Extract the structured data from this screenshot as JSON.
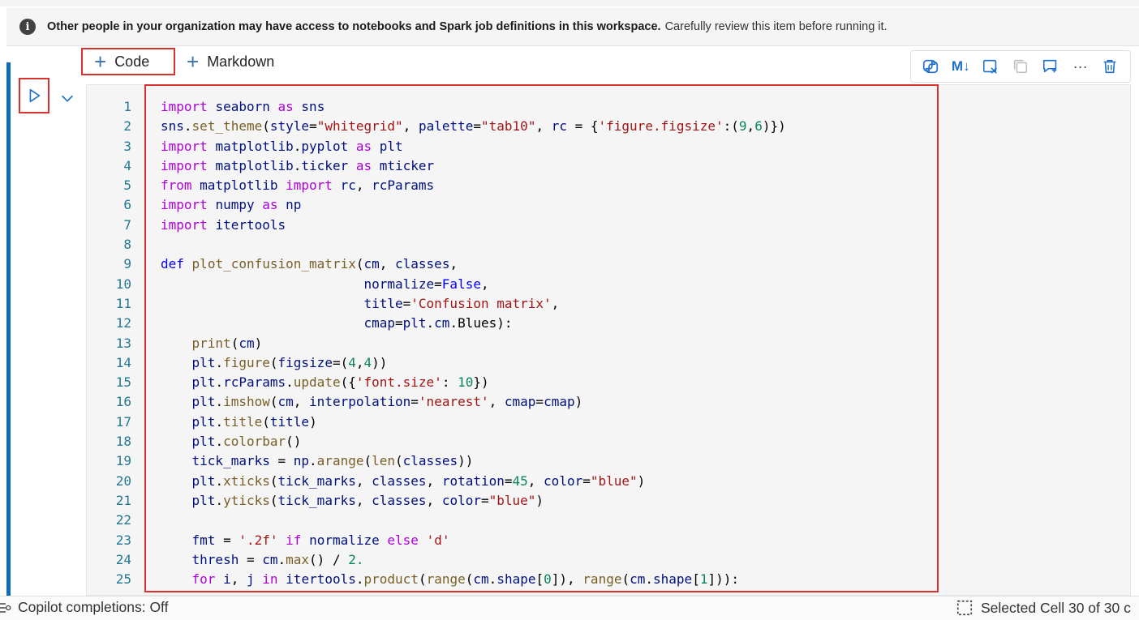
{
  "banner": {
    "bold_text": "Other people in your organization may have access to notebooks and Spark job definitions in this workspace.",
    "normal_text": "Carefully review this item before running it."
  },
  "add_toolbar": {
    "code_label": "Code",
    "markdown_label": "Markdown"
  },
  "cell_toolbar": {
    "markdown_toggle_label": "M↓",
    "more_label": "···",
    "icons": [
      "copilot-icon",
      "markdown-toggle-icon",
      "clear-output-icon",
      "copy-icon",
      "comment-icon",
      "more-icon",
      "delete-icon"
    ]
  },
  "colors": {
    "accent": "#0f6cbd",
    "highlight_border": "#d93030",
    "keyword": "#af00db",
    "string": "#a31515",
    "number": "#098658",
    "function": "#795e26",
    "variable": "#001080",
    "line_number": "#237893"
  },
  "code": {
    "lines": [
      [
        [
          "kw",
          "import"
        ],
        [
          "t",
          " "
        ],
        [
          "id",
          "seaborn"
        ],
        [
          "t",
          " "
        ],
        [
          "kw",
          "as"
        ],
        [
          "t",
          " "
        ],
        [
          "id",
          "sns"
        ]
      ],
      [
        [
          "id",
          "sns"
        ],
        [
          "t",
          "."
        ],
        [
          "fn",
          "set_theme"
        ],
        [
          "t",
          "("
        ],
        [
          "id",
          "style"
        ],
        [
          "t",
          "="
        ],
        [
          "st",
          "\"whitegrid\""
        ],
        [
          "t",
          ", "
        ],
        [
          "id",
          "palette"
        ],
        [
          "t",
          "="
        ],
        [
          "st",
          "\"tab10\""
        ],
        [
          "t",
          ", "
        ],
        [
          "id",
          "rc"
        ],
        [
          "t",
          " = {"
        ],
        [
          "st",
          "'figure.figsize'"
        ],
        [
          "t",
          ":("
        ],
        [
          "nm",
          "9"
        ],
        [
          "t",
          ","
        ],
        [
          "nm",
          "6"
        ],
        [
          "t",
          ")})"
        ]
      ],
      [
        [
          "kw",
          "import"
        ],
        [
          "t",
          " "
        ],
        [
          "id",
          "matplotlib"
        ],
        [
          "t",
          "."
        ],
        [
          "id",
          "pyplot"
        ],
        [
          "t",
          " "
        ],
        [
          "kw",
          "as"
        ],
        [
          "t",
          " "
        ],
        [
          "id",
          "plt"
        ]
      ],
      [
        [
          "kw",
          "import"
        ],
        [
          "t",
          " "
        ],
        [
          "id",
          "matplotlib"
        ],
        [
          "t",
          "."
        ],
        [
          "id",
          "ticker"
        ],
        [
          "t",
          " "
        ],
        [
          "kw",
          "as"
        ],
        [
          "t",
          " "
        ],
        [
          "id",
          "mticker"
        ]
      ],
      [
        [
          "kw",
          "from"
        ],
        [
          "t",
          " "
        ],
        [
          "id",
          "matplotlib"
        ],
        [
          "t",
          " "
        ],
        [
          "kw",
          "import"
        ],
        [
          "t",
          " "
        ],
        [
          "id",
          "rc"
        ],
        [
          "t",
          ", "
        ],
        [
          "id",
          "rcParams"
        ]
      ],
      [
        [
          "kw",
          "import"
        ],
        [
          "t",
          " "
        ],
        [
          "id",
          "numpy"
        ],
        [
          "t",
          " "
        ],
        [
          "kw",
          "as"
        ],
        [
          "t",
          " "
        ],
        [
          "id",
          "np"
        ]
      ],
      [
        [
          "kw",
          "import"
        ],
        [
          "t",
          " "
        ],
        [
          "id",
          "itertools"
        ]
      ],
      [],
      [
        [
          "kd",
          "def"
        ],
        [
          "t",
          " "
        ],
        [
          "fn",
          "plot_confusion_matrix"
        ],
        [
          "t",
          "("
        ],
        [
          "id",
          "cm"
        ],
        [
          "t",
          ", "
        ],
        [
          "id",
          "classes"
        ],
        [
          "t",
          ","
        ]
      ],
      [
        [
          "t",
          "                          "
        ],
        [
          "id",
          "normalize"
        ],
        [
          "t",
          "="
        ],
        [
          "kd",
          "False"
        ],
        [
          "t",
          ","
        ]
      ],
      [
        [
          "t",
          "                          "
        ],
        [
          "id",
          "title"
        ],
        [
          "t",
          "="
        ],
        [
          "st",
          "'Confusion matrix'"
        ],
        [
          "t",
          ","
        ]
      ],
      [
        [
          "t",
          "                          "
        ],
        [
          "id",
          "cmap"
        ],
        [
          "t",
          "="
        ],
        [
          "id",
          "plt"
        ],
        [
          "t",
          "."
        ],
        [
          "id",
          "cm"
        ],
        [
          "t",
          ".Blues):"
        ]
      ],
      [
        [
          "t",
          "    "
        ],
        [
          "fn",
          "print"
        ],
        [
          "t",
          "("
        ],
        [
          "id",
          "cm"
        ],
        [
          "t",
          ")"
        ]
      ],
      [
        [
          "t",
          "    "
        ],
        [
          "id",
          "plt"
        ],
        [
          "t",
          "."
        ],
        [
          "fn",
          "figure"
        ],
        [
          "t",
          "("
        ],
        [
          "id",
          "figsize"
        ],
        [
          "t",
          "=("
        ],
        [
          "nm",
          "4"
        ],
        [
          "t",
          ","
        ],
        [
          "nm",
          "4"
        ],
        [
          "t",
          "))"
        ]
      ],
      [
        [
          "t",
          "    "
        ],
        [
          "id",
          "plt"
        ],
        [
          "t",
          "."
        ],
        [
          "id",
          "rcParams"
        ],
        [
          "t",
          "."
        ],
        [
          "fn",
          "update"
        ],
        [
          "t",
          "({"
        ],
        [
          "st",
          "'font.size'"
        ],
        [
          "t",
          ": "
        ],
        [
          "nm",
          "10"
        ],
        [
          "t",
          "})"
        ]
      ],
      [
        [
          "t",
          "    "
        ],
        [
          "id",
          "plt"
        ],
        [
          "t",
          "."
        ],
        [
          "fn",
          "imshow"
        ],
        [
          "t",
          "("
        ],
        [
          "id",
          "cm"
        ],
        [
          "t",
          ", "
        ],
        [
          "id",
          "interpolation"
        ],
        [
          "t",
          "="
        ],
        [
          "st",
          "'nearest'"
        ],
        [
          "t",
          ", "
        ],
        [
          "id",
          "cmap"
        ],
        [
          "t",
          "="
        ],
        [
          "id",
          "cmap"
        ],
        [
          "t",
          ")"
        ]
      ],
      [
        [
          "t",
          "    "
        ],
        [
          "id",
          "plt"
        ],
        [
          "t",
          "."
        ],
        [
          "fn",
          "title"
        ],
        [
          "t",
          "("
        ],
        [
          "id",
          "title"
        ],
        [
          "t",
          ")"
        ]
      ],
      [
        [
          "t",
          "    "
        ],
        [
          "id",
          "plt"
        ],
        [
          "t",
          "."
        ],
        [
          "fn",
          "colorbar"
        ],
        [
          "t",
          "()"
        ]
      ],
      [
        [
          "t",
          "    "
        ],
        [
          "id",
          "tick_marks"
        ],
        [
          "t",
          " = "
        ],
        [
          "id",
          "np"
        ],
        [
          "t",
          "."
        ],
        [
          "fn",
          "arange"
        ],
        [
          "t",
          "("
        ],
        [
          "fn",
          "len"
        ],
        [
          "t",
          "("
        ],
        [
          "id",
          "classes"
        ],
        [
          "t",
          "))"
        ]
      ],
      [
        [
          "t",
          "    "
        ],
        [
          "id",
          "plt"
        ],
        [
          "t",
          "."
        ],
        [
          "fn",
          "xticks"
        ],
        [
          "t",
          "("
        ],
        [
          "id",
          "tick_marks"
        ],
        [
          "t",
          ", "
        ],
        [
          "id",
          "classes"
        ],
        [
          "t",
          ", "
        ],
        [
          "id",
          "rotation"
        ],
        [
          "t",
          "="
        ],
        [
          "nm",
          "45"
        ],
        [
          "t",
          ", "
        ],
        [
          "id",
          "color"
        ],
        [
          "t",
          "="
        ],
        [
          "st",
          "\"blue\""
        ],
        [
          "t",
          ")"
        ]
      ],
      [
        [
          "t",
          "    "
        ],
        [
          "id",
          "plt"
        ],
        [
          "t",
          "."
        ],
        [
          "fn",
          "yticks"
        ],
        [
          "t",
          "("
        ],
        [
          "id",
          "tick_marks"
        ],
        [
          "t",
          ", "
        ],
        [
          "id",
          "classes"
        ],
        [
          "t",
          ", "
        ],
        [
          "id",
          "color"
        ],
        [
          "t",
          "="
        ],
        [
          "st",
          "\"blue\""
        ],
        [
          "t",
          ")"
        ]
      ],
      [],
      [
        [
          "t",
          "    "
        ],
        [
          "id",
          "fmt"
        ],
        [
          "t",
          " = "
        ],
        [
          "st",
          "'.2f'"
        ],
        [
          "t",
          " "
        ],
        [
          "kw",
          "if"
        ],
        [
          "t",
          " "
        ],
        [
          "id",
          "normalize"
        ],
        [
          "t",
          " "
        ],
        [
          "kw",
          "else"
        ],
        [
          "t",
          " "
        ],
        [
          "st",
          "'d'"
        ]
      ],
      [
        [
          "t",
          "    "
        ],
        [
          "id",
          "thresh"
        ],
        [
          "t",
          " = "
        ],
        [
          "id",
          "cm"
        ],
        [
          "t",
          "."
        ],
        [
          "fn",
          "max"
        ],
        [
          "t",
          "() / "
        ],
        [
          "nm",
          "2."
        ]
      ],
      [
        [
          "t",
          "    "
        ],
        [
          "kw",
          "for"
        ],
        [
          "t",
          " "
        ],
        [
          "id",
          "i"
        ],
        [
          "t",
          ", "
        ],
        [
          "id",
          "j"
        ],
        [
          "t",
          " "
        ],
        [
          "kw",
          "in"
        ],
        [
          "t",
          " "
        ],
        [
          "id",
          "itertools"
        ],
        [
          "t",
          "."
        ],
        [
          "fn",
          "product"
        ],
        [
          "t",
          "("
        ],
        [
          "fn",
          "range"
        ],
        [
          "t",
          "("
        ],
        [
          "id",
          "cm"
        ],
        [
          "t",
          "."
        ],
        [
          "id",
          "shape"
        ],
        [
          "t",
          "["
        ],
        [
          "nm",
          "0"
        ],
        [
          "t",
          "]), "
        ],
        [
          "fn",
          "range"
        ],
        [
          "t",
          "("
        ],
        [
          "id",
          "cm"
        ],
        [
          "t",
          "."
        ],
        [
          "id",
          "shape"
        ],
        [
          "t",
          "["
        ],
        [
          "nm",
          "1"
        ],
        [
          "t",
          "])):"
        ]
      ]
    ]
  },
  "status": {
    "copilot": "Copilot completions: Off",
    "selection": "Selected Cell 30 of 30 c"
  }
}
